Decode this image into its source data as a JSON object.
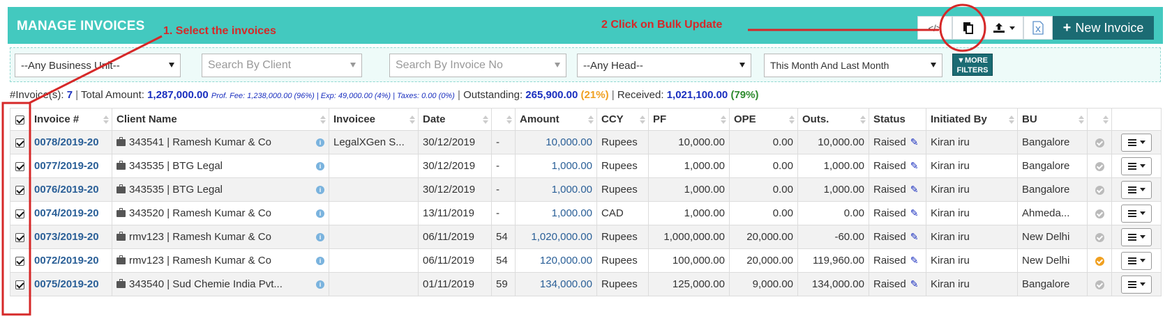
{
  "header": {
    "title": "MANAGE INVOICES",
    "code_label": "</>",
    "new_invoice_label": "New Invoice"
  },
  "annotations": {
    "step1": "1. Select the invoices",
    "step2": "2 Click on Bulk Update"
  },
  "filters": {
    "business_unit": "--Any Business Unit--",
    "client_placeholder": "Search By Client",
    "invoice_placeholder": "Search By Invoice No",
    "head": "--Any Head--",
    "date_range": "This Month And Last Month",
    "more_filters_line1": "MORE",
    "more_filters_line2": "FILTERS"
  },
  "summary": {
    "count_label": "#Invoice(s):",
    "count": "7",
    "total_label": "Total Amount:",
    "total": "1,287,000.00",
    "breakdown": "Prof. Fee: 1,238,000.00 (96%) | Exp: 49,000.00 (4%) | Taxes: 0.00 (0%)",
    "outstanding_label": "Outstanding:",
    "outstanding": "265,900.00",
    "outstanding_pct": "(21%)",
    "received_label": "Received:",
    "received": "1,021,100.00",
    "received_pct": "(79%)"
  },
  "columns": [
    "Invoice #",
    "Client Name",
    "Invoicee",
    "Date",
    "",
    "Amount",
    "CCY",
    "PF",
    "OPE",
    "Outs.",
    "Status",
    "Initiated By",
    "BU"
  ],
  "rows": [
    {
      "invoice": "0078/2019-20",
      "client": "343541 | Ramesh Kumar & Co",
      "invoicee": "LegalXGen S...",
      "date": "30/12/2019",
      "days": "-",
      "amount": "10,000.00",
      "ccy": "Rupees",
      "pf": "10,000.00",
      "ope": "0.00",
      "outs": "10,000.00",
      "status": "Raised",
      "by": "Kiran iru",
      "bu": "Bangalore",
      "flag": "grey"
    },
    {
      "invoice": "0077/2019-20",
      "client": "343535 | BTG Legal",
      "invoicee": "",
      "date": "30/12/2019",
      "days": "-",
      "amount": "1,000.00",
      "ccy": "Rupees",
      "pf": "1,000.00",
      "ope": "0.00",
      "outs": "1,000.00",
      "status": "Raised",
      "by": "Kiran iru",
      "bu": "Bangalore",
      "flag": "grey"
    },
    {
      "invoice": "0076/2019-20",
      "client": "343535 | BTG Legal",
      "invoicee": "",
      "date": "30/12/2019",
      "days": "-",
      "amount": "1,000.00",
      "ccy": "Rupees",
      "pf": "1,000.00",
      "ope": "0.00",
      "outs": "1,000.00",
      "status": "Raised",
      "by": "Kiran iru",
      "bu": "Bangalore",
      "flag": "grey"
    },
    {
      "invoice": "0074/2019-20",
      "client": "343520 | Ramesh Kumar & Co",
      "invoicee": "",
      "date": "13/11/2019",
      "days": "-",
      "amount": "1,000.00",
      "ccy": "CAD",
      "pf": "1,000.00",
      "ope": "0.00",
      "outs": "0.00",
      "status": "Raised",
      "by": "Kiran iru",
      "bu": "Ahmeda...",
      "flag": "grey"
    },
    {
      "invoice": "0073/2019-20",
      "client": "rmv123 | Ramesh Kumar & Co",
      "invoicee": "",
      "date": "06/11/2019",
      "days": "54",
      "amount": "1,020,000.00",
      "ccy": "Rupees",
      "pf": "1,000,000.00",
      "ope": "20,000.00",
      "outs": "-60.00",
      "status": "Raised",
      "by": "Kiran iru",
      "bu": "New Delhi",
      "flag": "grey"
    },
    {
      "invoice": "0072/2019-20",
      "client": "rmv123 | Ramesh Kumar & Co",
      "invoicee": "",
      "date": "06/11/2019",
      "days": "54",
      "amount": "120,000.00",
      "ccy": "Rupees",
      "pf": "100,000.00",
      "ope": "20,000.00",
      "outs": "119,960.00",
      "status": "Raised",
      "by": "Kiran iru",
      "bu": "New Delhi",
      "flag": "orange"
    },
    {
      "invoice": "0075/2019-20",
      "client": "343540 | Sud Chemie India Pvt...",
      "invoicee": "",
      "date": "01/11/2019",
      "days": "59",
      "amount": "134,000.00",
      "ccy": "Rupees",
      "pf": "125,000.00",
      "ope": "9,000.00",
      "outs": "134,000.00",
      "status": "Raised",
      "by": "Kiran iru",
      "bu": "Bangalore",
      "flag": "grey"
    }
  ]
}
